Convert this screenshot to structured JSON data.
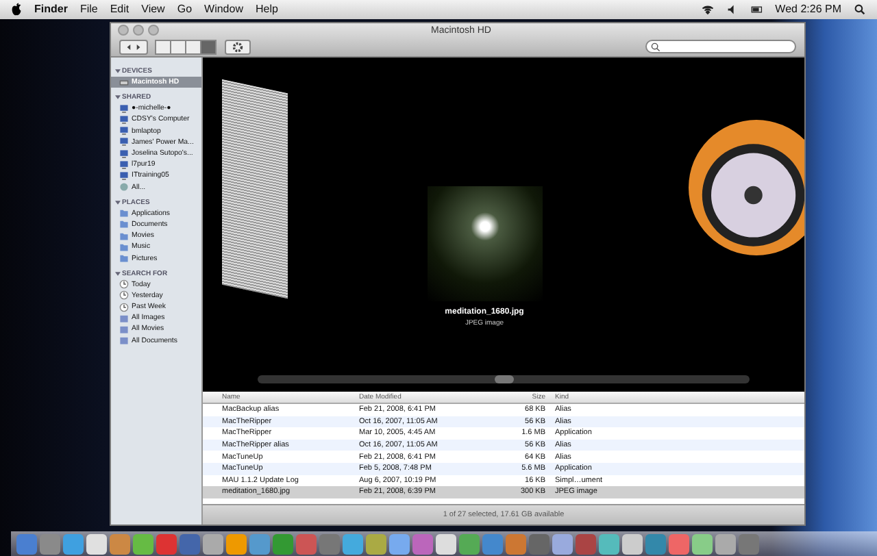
{
  "menubar": {
    "menus": [
      "Finder",
      "File",
      "Edit",
      "View",
      "Go",
      "Window",
      "Help"
    ],
    "clock": "Wed 2:26 PM"
  },
  "window": {
    "title": "Macintosh HD"
  },
  "sidebar": {
    "sections": [
      {
        "title": "DEVICES",
        "items": [
          {
            "label": "Macintosh HD",
            "kind": "disk",
            "selected": true
          }
        ]
      },
      {
        "title": "SHARED",
        "items": [
          {
            "label": "●-michelle-●",
            "kind": "computer",
            "selected": false
          },
          {
            "label": "CDSY's Computer",
            "kind": "computer",
            "selected": false
          },
          {
            "label": "bmlaptop",
            "kind": "computer",
            "selected": false
          },
          {
            "label": "James' Power Ma...",
            "kind": "computer",
            "selected": false
          },
          {
            "label": "Joselina Sutopo's...",
            "kind": "computer",
            "selected": false
          },
          {
            "label": "l7pur19",
            "kind": "computer",
            "selected": false
          },
          {
            "label": "ITtraining05",
            "kind": "computer",
            "selected": false
          },
          {
            "label": "All...",
            "kind": "network",
            "selected": false
          }
        ]
      },
      {
        "title": "PLACES",
        "items": [
          {
            "label": "Applications",
            "kind": "folder",
            "selected": false
          },
          {
            "label": "Documents",
            "kind": "folder",
            "selected": false
          },
          {
            "label": "Movies",
            "kind": "folder",
            "selected": false
          },
          {
            "label": "Music",
            "kind": "folder",
            "selected": false
          },
          {
            "label": "Pictures",
            "kind": "folder",
            "selected": false
          }
        ]
      },
      {
        "title": "SEARCH FOR",
        "items": [
          {
            "label": "Today",
            "kind": "clock",
            "selected": false
          },
          {
            "label": "Yesterday",
            "kind": "clock",
            "selected": false
          },
          {
            "label": "Past Week",
            "kind": "clock",
            "selected": false
          },
          {
            "label": "All Images",
            "kind": "smart",
            "selected": false
          },
          {
            "label": "All Movies",
            "kind": "smart",
            "selected": false
          },
          {
            "label": "All Documents",
            "kind": "smart",
            "selected": false
          }
        ]
      }
    ]
  },
  "coverflow": {
    "caption": "meditation_1680.jpg",
    "subcaption": "JPEG image"
  },
  "table": {
    "columns": [
      "Name",
      "Date Modified",
      "Size",
      "Kind"
    ],
    "rows": [
      {
        "cells": [
          "MacBackup alias",
          "Feb 21, 2008, 6:41 PM",
          "68 KB",
          "Alias"
        ],
        "selected": false
      },
      {
        "cells": [
          "MacTheRipper",
          "Oct 16, 2007, 11:05 AM",
          "56 KB",
          "Alias"
        ],
        "selected": false
      },
      {
        "cells": [
          "MacTheRipper",
          "Mar 10, 2005, 4:45 AM",
          "1.6 MB",
          "Application"
        ],
        "selected": false
      },
      {
        "cells": [
          "MacTheRipper alias",
          "Oct 16, 2007, 11:05 AM",
          "56 KB",
          "Alias"
        ],
        "selected": false
      },
      {
        "cells": [
          "MacTuneUp",
          "Feb 21, 2008, 6:41 PM",
          "64 KB",
          "Alias"
        ],
        "selected": false
      },
      {
        "cells": [
          "MacTuneUp",
          "Feb 5, 2008, 7:48 PM",
          "5.6 MB",
          "Application"
        ],
        "selected": false
      },
      {
        "cells": [
          "MAU 1.1.2 Update Log",
          "Aug 6, 2007, 10:19 PM",
          "16 KB",
          "Simpl…ument"
        ],
        "selected": false
      },
      {
        "cells": [
          "meditation_1680.jpg",
          "Feb 21, 2008, 6:39 PM",
          "300 KB",
          "JPEG image"
        ],
        "selected": true
      }
    ]
  },
  "status_bar": "1 of 27 selected, 17.61 GB available"
}
